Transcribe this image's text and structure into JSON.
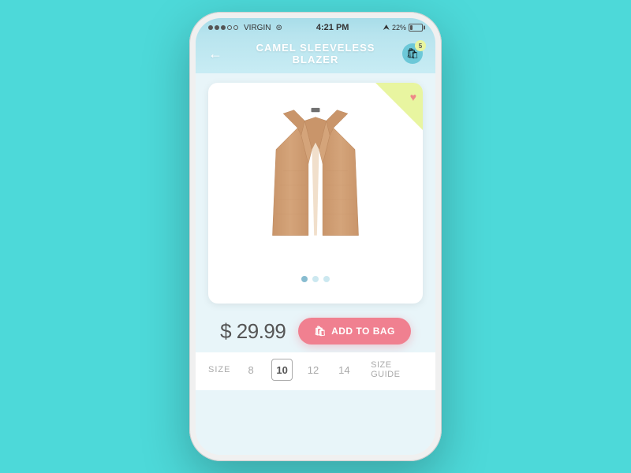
{
  "statusBar": {
    "carrier": "VIRGIN",
    "time": "4:21 PM",
    "battery": "22%",
    "signalDots": 3,
    "emptyDots": 2
  },
  "header": {
    "title": "CAMEL SLEEVELESS BLAZER",
    "backLabel": "←",
    "cartCount": "5"
  },
  "product": {
    "price": "$ 29.99",
    "addToBagLabel": "ADD TO BAG",
    "isFavorited": true
  },
  "sizes": {
    "label": "SIZE",
    "options": [
      "8",
      "10",
      "12",
      "14"
    ],
    "selected": "10",
    "guideLabel": "SIZE GUIDE"
  },
  "imageDots": {
    "total": 3,
    "activeIndex": 0
  }
}
